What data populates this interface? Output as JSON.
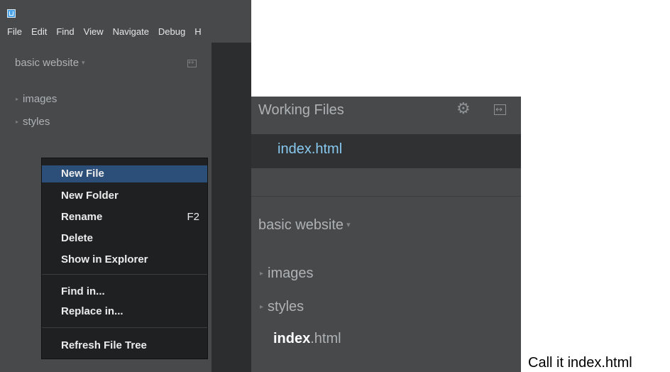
{
  "menubar": {
    "items": [
      "File",
      "Edit",
      "Find",
      "View",
      "Navigate",
      "Debug",
      "H"
    ]
  },
  "left_sidebar": {
    "project_name": "basic website",
    "project_caret": "▾",
    "tree": [
      {
        "label": "images",
        "type": "folder"
      },
      {
        "label": "styles",
        "type": "folder"
      }
    ],
    "tree_arrow": "▸"
  },
  "context_menu": {
    "items": [
      {
        "label": "New File",
        "shortcut": "",
        "active": true
      },
      {
        "label": "New Folder",
        "shortcut": ""
      },
      {
        "label": "Rename",
        "shortcut": "F2"
      },
      {
        "label": "Delete",
        "shortcut": ""
      },
      {
        "label": "Show in Explorer",
        "shortcut": ""
      },
      {
        "label": "Find in...",
        "shortcut": ""
      },
      {
        "label": "Replace in...",
        "shortcut": ""
      },
      {
        "label": "Refresh File Tree",
        "shortcut": ""
      }
    ]
  },
  "right_sidebar": {
    "working_files_title": "Working Files",
    "working_file": "index.html",
    "project_name": "basic website",
    "project_caret": "▾",
    "tree_arrow": "▸",
    "tree": [
      {
        "label": "images",
        "type": "folder"
      },
      {
        "label": "styles",
        "type": "folder"
      }
    ],
    "file_name": "index",
    "file_ext": ".html"
  },
  "caption": "Call it index.html",
  "icons": {
    "gear": "gear-icon",
    "split": "split-view-icon",
    "app": "brackets-app-icon"
  },
  "colors": {
    "sidebar_bg": "#47494b",
    "menu_bg": "#1f2022",
    "menu_highlight": "#2b4f78",
    "working_file_color": "#89c9ef"
  }
}
